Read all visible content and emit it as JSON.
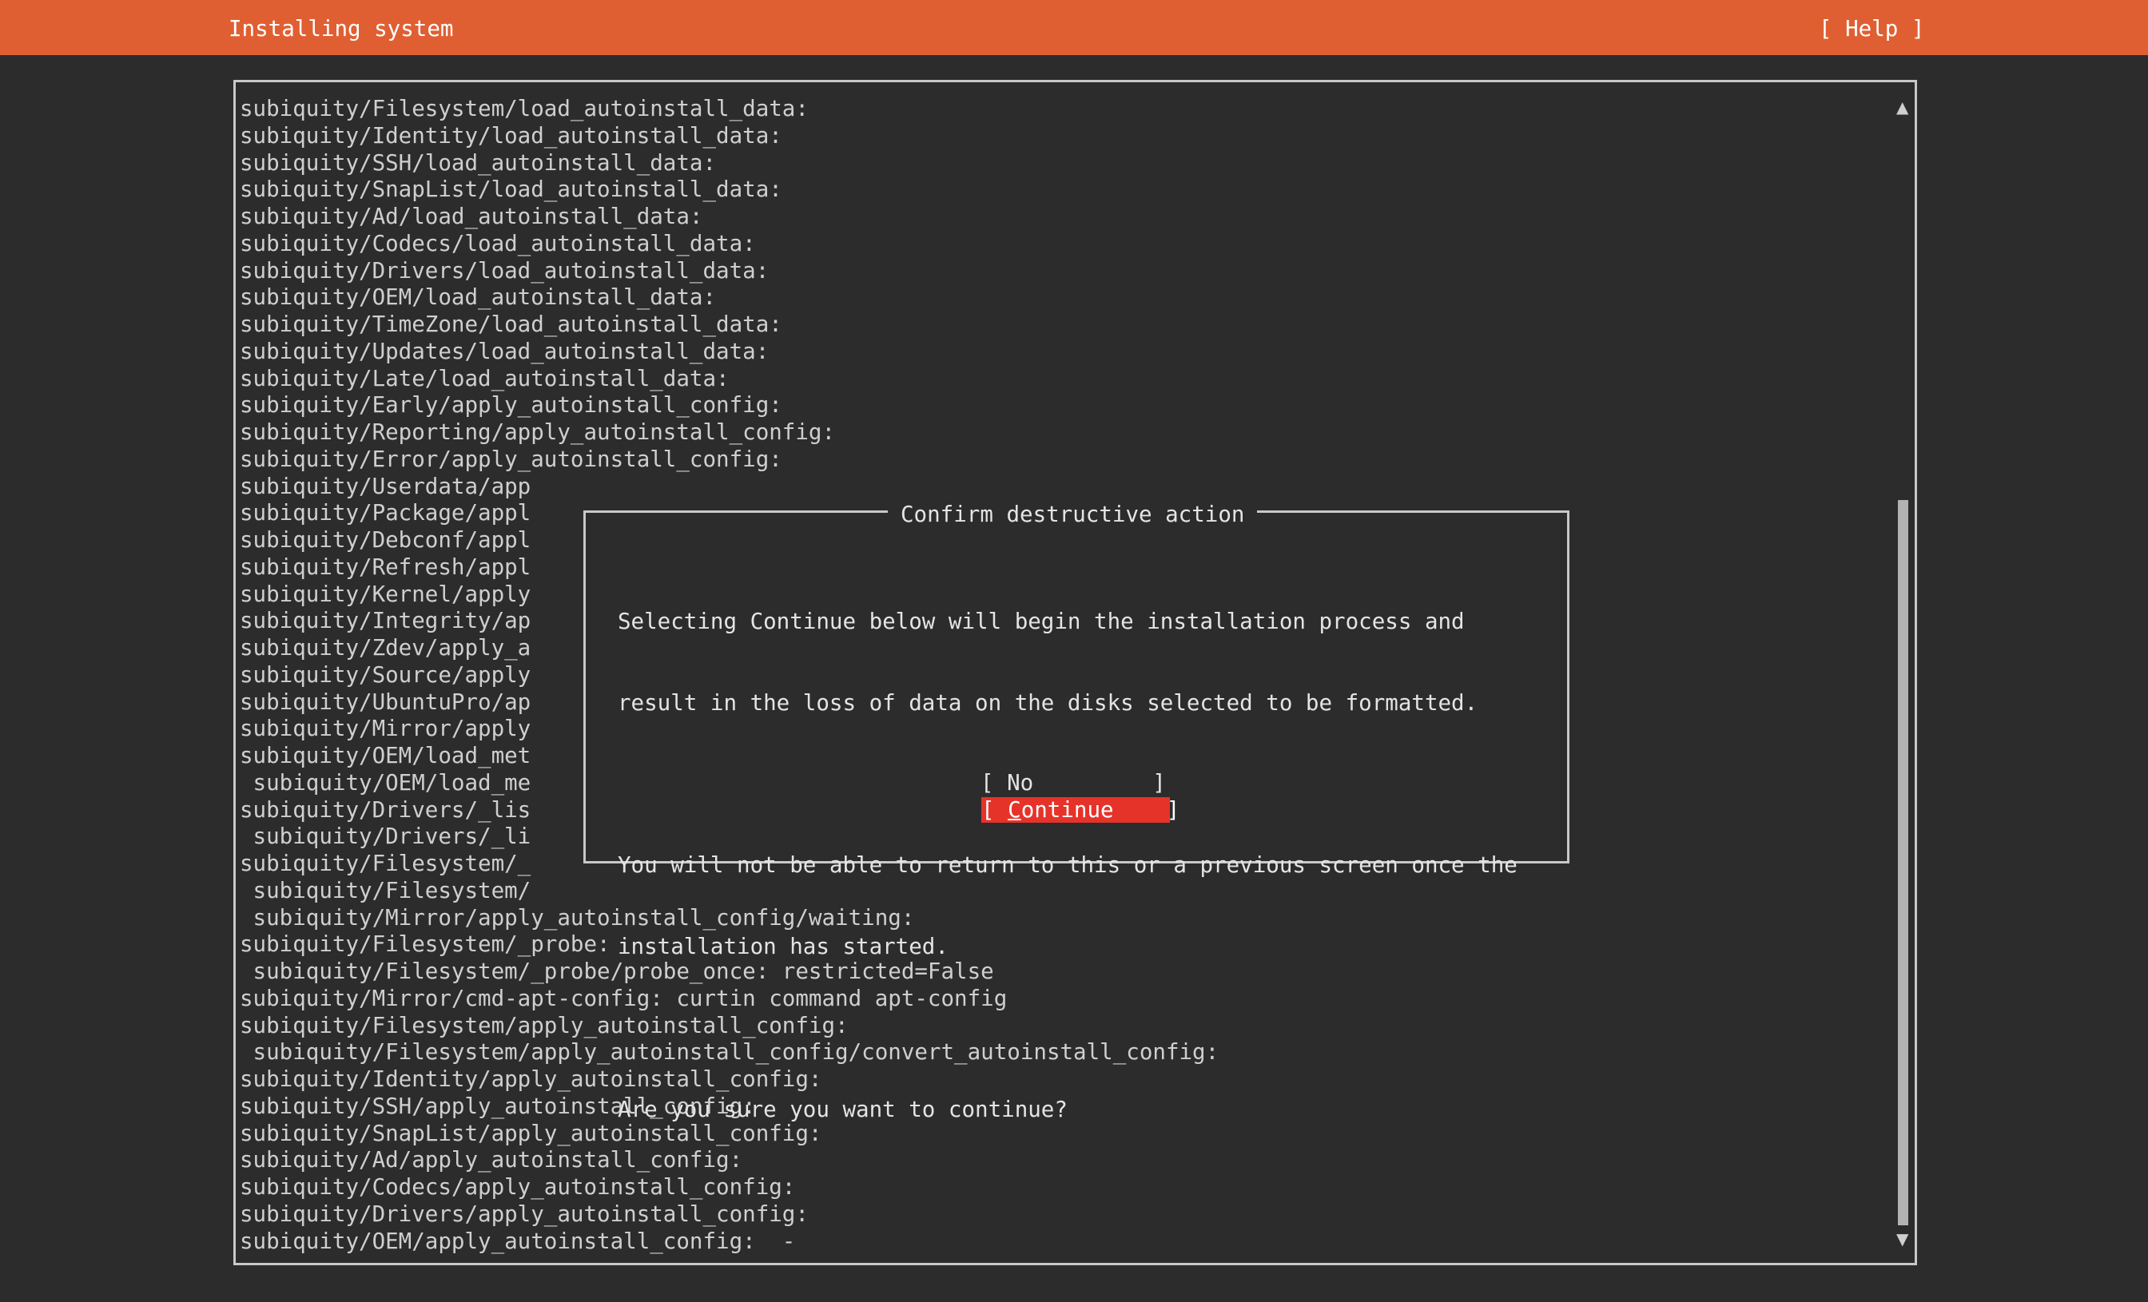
{
  "header": {
    "title": "Installing system",
    "help_label": "[ Help ]"
  },
  "log": {
    "lines": [
      "subiquity/Filesystem/load_autoinstall_data:",
      "subiquity/Identity/load_autoinstall_data:",
      "subiquity/SSH/load_autoinstall_data:",
      "subiquity/SnapList/load_autoinstall_data:",
      "subiquity/Ad/load_autoinstall_data:",
      "subiquity/Codecs/load_autoinstall_data:",
      "subiquity/Drivers/load_autoinstall_data:",
      "subiquity/OEM/load_autoinstall_data:",
      "subiquity/TimeZone/load_autoinstall_data:",
      "subiquity/Updates/load_autoinstall_data:",
      "subiquity/Late/load_autoinstall_data:",
      "subiquity/Early/apply_autoinstall_config:",
      "subiquity/Reporting/apply_autoinstall_config:",
      "subiquity/Error/apply_autoinstall_config:",
      "subiquity/Userdata/app",
      "subiquity/Package/appl",
      "subiquity/Debconf/appl",
      "subiquity/Refresh/appl",
      "subiquity/Kernel/apply",
      "subiquity/Integrity/ap",
      "subiquity/Zdev/apply_a",
      "subiquity/Source/apply",
      "subiquity/UbuntuPro/ap",
      "subiquity/Mirror/apply",
      "subiquity/OEM/load_met",
      " subiquity/OEM/load_me",
      "subiquity/Drivers/_lis",
      " subiquity/Drivers/_li",
      "subiquity/Filesystem/_",
      " subiquity/Filesystem/",
      " subiquity/Mirror/apply_autoinstall_config/waiting:",
      "subiquity/Filesystem/_probe:",
      " subiquity/Filesystem/_probe/probe_once: restricted=False",
      "subiquity/Mirror/cmd-apt-config: curtin command apt-config",
      "subiquity/Filesystem/apply_autoinstall_config:",
      " subiquity/Filesystem/apply_autoinstall_config/convert_autoinstall_config:",
      "subiquity/Identity/apply_autoinstall_config:",
      "subiquity/SSH/apply_autoinstall_config:",
      "subiquity/SnapList/apply_autoinstall_config:",
      "subiquity/Ad/apply_autoinstall_config:",
      "subiquity/Codecs/apply_autoinstall_config:",
      "subiquity/Drivers/apply_autoinstall_config:",
      "subiquity/OEM/apply_autoinstall_config:  -"
    ]
  },
  "dialog": {
    "title": "Confirm destructive action",
    "line1": "Selecting Continue below will begin the installation process and",
    "line2": "result in the loss of data on the disks selected to be formatted.",
    "line3": "",
    "line4": "You will not be able to return to this or a previous screen once the",
    "line5": "installation has started.",
    "line6": "",
    "line7": "Are you sure you want to continue?",
    "no_label": "[ No         ]",
    "continue_prefix": "[ ",
    "continue_cursor": "C",
    "continue_rest": "ontinue    ]"
  },
  "icons": {
    "scroll_up": "triangle-up-icon",
    "scroll_down": "triangle-down-icon"
  },
  "colors": {
    "header_bg": "#e05f32",
    "background": "#2c2c2c",
    "focus_button_bg": "#e6332a",
    "text": "#d2d2d2"
  }
}
